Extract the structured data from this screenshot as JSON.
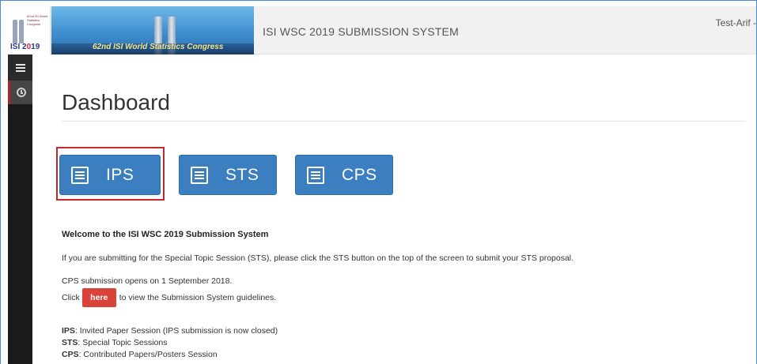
{
  "header": {
    "logo_text_left": "ISI 2",
    "logo_text_mid": "0",
    "logo_text_right": "19",
    "logo_small_text": "62nd ISI World Statistics Congress",
    "banner_text": "62nd ISI World Statistics Congress",
    "system_title": "ISI WSC 2019 SUBMISSION SYSTEM",
    "user_name": "Test-Arif -"
  },
  "sidebar": {
    "items": [
      {
        "name": "menu",
        "icon": "hamburger-icon"
      },
      {
        "name": "dashboard",
        "icon": "clock-icon"
      }
    ]
  },
  "main": {
    "title": "Dashboard",
    "session_buttons": [
      {
        "label": "IPS",
        "icon": "form-icon"
      },
      {
        "label": "STS",
        "icon": "form-icon"
      },
      {
        "label": "CPS",
        "icon": "form-icon"
      }
    ],
    "welcome_heading": "Welcome to the ISI WSC 2019 Submission System",
    "sts_notice": "If you are submitting for the Special Topic Session (STS), please click the STS button on the top of the screen to submit your STS proposal.",
    "cps_notice": "CPS submission opens on 1 September 2018.",
    "click_prefix": "Click",
    "here_label": "here",
    "click_suffix": "to view the Submission System guidelines.",
    "abbreviations": [
      {
        "code": "IPS",
        "desc": ": Invited Paper Session (IPS submission is now closed)"
      },
      {
        "code": "STS",
        "desc": ": Special Topic Sessions"
      },
      {
        "code": "CPS",
        "desc": ": Contributed Papers/Posters Session"
      }
    ]
  },
  "colors": {
    "primary_button": "#3c7fc0",
    "highlight_border": "#c0282d",
    "here_button": "#d9433a",
    "sidebar_bg": "#1b1b1b"
  }
}
